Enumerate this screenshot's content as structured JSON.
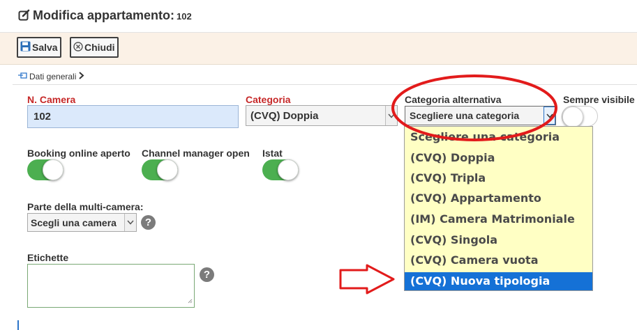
{
  "title": {
    "label": "Modifica appartamento:",
    "number": "102"
  },
  "toolbar": {
    "save_label": "Salva",
    "close_label": "Chiudi"
  },
  "section": {
    "label": "Dati generali"
  },
  "fields": {
    "room_number": {
      "label": "N. Camera",
      "value": "102"
    },
    "category": {
      "label": "Categoria",
      "value": "(CVQ) Doppia"
    },
    "alt_category": {
      "label": "Categoria alternativa",
      "value": "Scegliere una categoria"
    },
    "always_visible": {
      "label": "Sempre visibile"
    },
    "booking_online": {
      "label": "Booking online aperto",
      "on": true
    },
    "channel_manager": {
      "label": "Channel manager open",
      "on": true
    },
    "istat": {
      "label": "Istat",
      "on": true
    },
    "multi_room": {
      "label": "Parte della multi-camera:",
      "value": "Scegli una camera"
    },
    "tags": {
      "label": "Etichette",
      "value": ""
    }
  },
  "alt_category_options": [
    {
      "label": "Scegliere una categoria",
      "selected": false
    },
    {
      "label": "(CVQ) Doppia",
      "selected": false
    },
    {
      "label": "(CVQ) Tripla",
      "selected": false
    },
    {
      "label": "(CVQ) Appartamento",
      "selected": false
    },
    {
      "label": "(IM) Camera Matrimoniale",
      "selected": false
    },
    {
      "label": "(CVQ) Singola",
      "selected": false
    },
    {
      "label": "(CVQ) Camera vuota",
      "selected": false
    },
    {
      "label": "(CVQ) Nuova tipologia",
      "selected": true
    }
  ],
  "help_glyph": "?",
  "colors": {
    "accent_red": "#c62828",
    "toggle_green": "#4caf50",
    "selection_blue": "#1571d6",
    "annotation_red": "#e21b1b",
    "dropdown_bg": "#ffffc4"
  }
}
